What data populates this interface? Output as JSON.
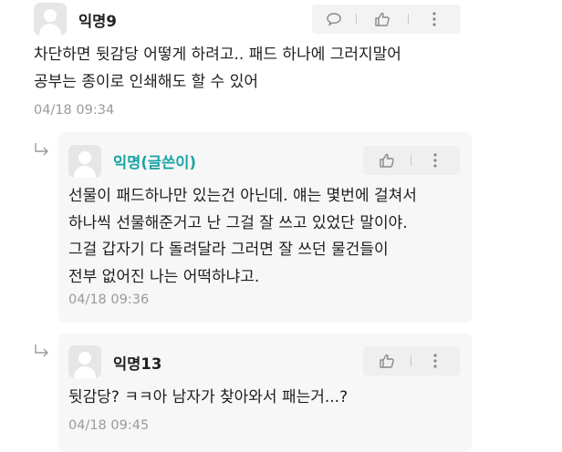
{
  "comments": [
    {
      "author": "익명9",
      "lines": [
        "차단하면 뒷감당 어떻게 하려고.. 패드 하나에 그러지말어",
        "공부는 종이로 인쇄해도 할 수 있어"
      ],
      "date": "04/18 09:34"
    }
  ],
  "replies": [
    {
      "author": "익명(글쓴이)",
      "lines": [
        "선물이 패드하나만 있는건 아닌데. 얘는 몇번에 걸쳐서",
        "하나씩 선물해준거고 난 그걸 잘 쓰고 있었단 말이야.",
        "그걸 갑자기 다 돌려달라 그러면 잘 쓰던 물건들이",
        "전부 없어진 나는 어떡하냐고."
      ],
      "date": "04/18 09:36"
    },
    {
      "author": "익명13",
      "lines": [
        "뒷감당? ㅋㅋ아 남자가 찾아와서 패는거...?"
      ],
      "date": "04/18 09:45"
    }
  ],
  "colors": {
    "author_name": "#1aa3a3",
    "date": "#9a9a9a",
    "reply_bg": "#f7f7f7"
  },
  "icons": [
    "reply-icon",
    "like-icon",
    "more-icon",
    "reply-indent-arrow-icon"
  ]
}
